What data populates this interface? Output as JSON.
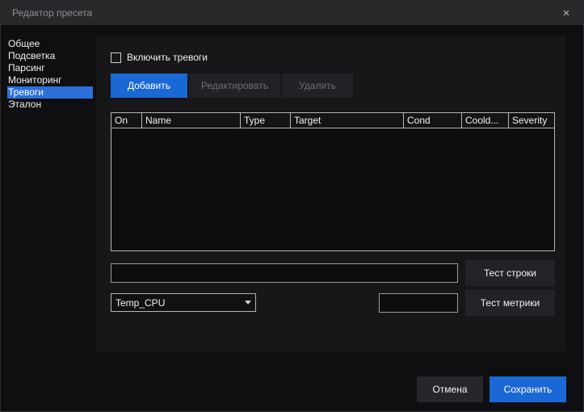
{
  "window": {
    "title": "Редактор пресета",
    "close_glyph": "×"
  },
  "sidebar": {
    "items": [
      {
        "label": "Общее",
        "selected": false
      },
      {
        "label": "Подсветка",
        "selected": false
      },
      {
        "label": "Парсинг",
        "selected": false
      },
      {
        "label": "Мониторинг",
        "selected": false
      },
      {
        "label": "Тревоги",
        "selected": true
      },
      {
        "label": "Эталон",
        "selected": false
      }
    ]
  },
  "main": {
    "enable_alarms_label": "Включить тревоги",
    "enable_alarms_checked": false,
    "toolbar": {
      "add_label": "Добавить",
      "edit_label": "Редактировать",
      "delete_label": "Удалить"
    },
    "table": {
      "columns": [
        "On",
        "Name",
        "Type",
        "Target",
        "Cond",
        "Coold...",
        "Severity"
      ],
      "rows": []
    },
    "string_test": {
      "input_value": "",
      "button_label": "Тест строки"
    },
    "metric_test": {
      "combo_value": "Temp_CPU",
      "input_value": "",
      "button_label": "Тест метрики"
    }
  },
  "footer": {
    "cancel_label": "Отмена",
    "save_label": "Сохранить"
  },
  "colors": {
    "accent_blue": "#1a68d6",
    "selection_blue": "#2b6fd9",
    "panel_bg": "#17171a",
    "window_bg": "#0f0f12",
    "titlebar_bg": "#29292c"
  }
}
